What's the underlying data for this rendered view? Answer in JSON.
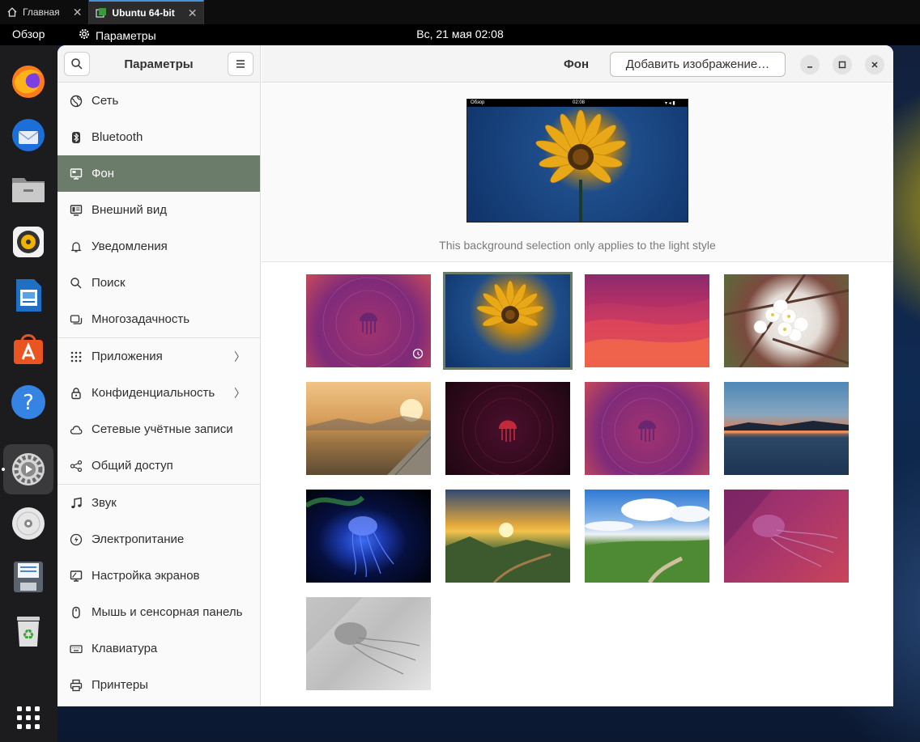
{
  "host_tabs": [
    {
      "label": "Главная"
    },
    {
      "label": "Ubuntu 64-bit"
    }
  ],
  "topbar": {
    "overview": "Обзор",
    "app": "Параметры",
    "clock": "Вс, 21 мая  02:08"
  },
  "dock": [
    "firefox",
    "thunderbird",
    "files",
    "rhythmbox",
    "libreoffice-writer",
    "app-center",
    "help",
    "settings",
    "dvd",
    "save",
    "trash",
    "show-apps"
  ],
  "sidebar": {
    "title": "Параметры",
    "items": [
      {
        "label": "Сеть",
        "icon": "globe-icon"
      },
      {
        "label": "Bluetooth",
        "icon": "bluetooth-icon"
      },
      {
        "label": "Фон",
        "icon": "monitor-icon"
      },
      {
        "label": "Внешний вид",
        "icon": "appearance-icon"
      },
      {
        "label": "Уведомления",
        "icon": "bell-icon"
      },
      {
        "label": "Поиск",
        "icon": "search-icon"
      },
      {
        "label": "Многозадачность",
        "icon": "multitasking-icon"
      },
      {
        "label": "Приложения",
        "icon": "apps-grid-icon"
      },
      {
        "label": "Конфиденциальность",
        "icon": "lock-icon"
      },
      {
        "label": "Сетевые учётные записи",
        "icon": "cloud-icon"
      },
      {
        "label": "Общий доступ",
        "icon": "share-icon"
      },
      {
        "label": "Звук",
        "icon": "music-note-icon"
      },
      {
        "label": "Электропитание",
        "icon": "power-icon"
      },
      {
        "label": "Настройка экранов",
        "icon": "display-icon"
      },
      {
        "label": "Мышь и сенсорная панель",
        "icon": "mouse-icon"
      },
      {
        "label": "Клавиатура",
        "icon": "keyboard-icon"
      },
      {
        "label": "Принтеры",
        "icon": "printer-icon"
      }
    ]
  },
  "main": {
    "title": "Фон",
    "add_button": "Добавить изображение…",
    "preview_bar": {
      "left": "Обзор",
      "center": "02:08"
    },
    "preview_note": "This background selection only applies to the light style"
  },
  "colors": {
    "accent": "#6b7d6a",
    "topbar": "#000000",
    "dock": "#1c1c1e"
  }
}
